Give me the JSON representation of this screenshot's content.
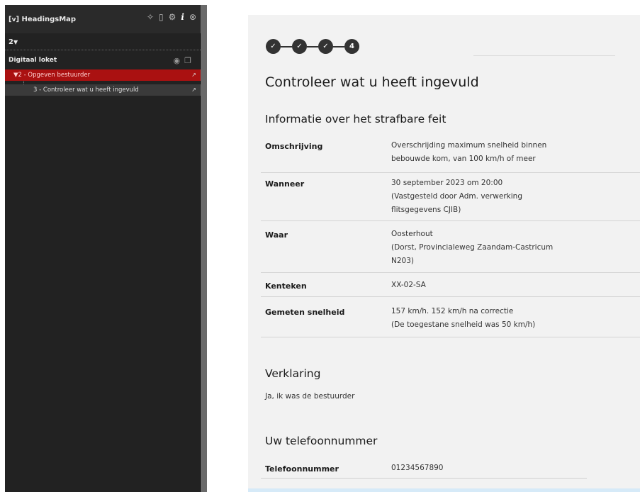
{
  "sidebar": {
    "title": "HeadingsMap",
    "level": "2",
    "section_title": "Digitaal loket",
    "items": [
      {
        "label": "2 - Opgeven bestuurder",
        "active": true
      },
      {
        "label": "3 - Controleer wat u heeft ingevuld",
        "active": false
      }
    ]
  },
  "page": {
    "steps": [
      "✓",
      "✓",
      "✓",
      "4"
    ],
    "heading": "Controleer wat u heeft ingevuld",
    "info_section": {
      "heading": "Informatie over het strafbare feit",
      "rows": [
        {
          "label": "Omschrijving",
          "lines": [
            "Overschrijding maximum snelheid binnen",
            "bebouwde kom, van 100 km/h of meer"
          ]
        },
        {
          "label": "Wanneer",
          "lines": [
            "30 september 2023 om 20:00",
            "(Vastgesteld door Adm. verwerking",
            "flitsgegevens CJIB)"
          ]
        },
        {
          "label": "Waar",
          "lines": [
            "Oosterhout",
            "(Dorst, Provincialeweg Zaandam-Castricum",
            "N203)"
          ]
        },
        {
          "label": "Kenteken",
          "lines": [
            "XX-02-SA"
          ]
        },
        {
          "label": "Gemeten snelheid",
          "lines": [
            "157 km/h. 152 km/h na correctie",
            "(De toegestane snelheid was 50 km/h)"
          ]
        }
      ]
    },
    "verklaring": {
      "heading": "Verklaring",
      "text": "Ja, ik was de bestuurder"
    },
    "phone_section": {
      "heading": "Uw telefoonnummer",
      "label": "Telefoonnummer",
      "value": "01234567890"
    }
  }
}
